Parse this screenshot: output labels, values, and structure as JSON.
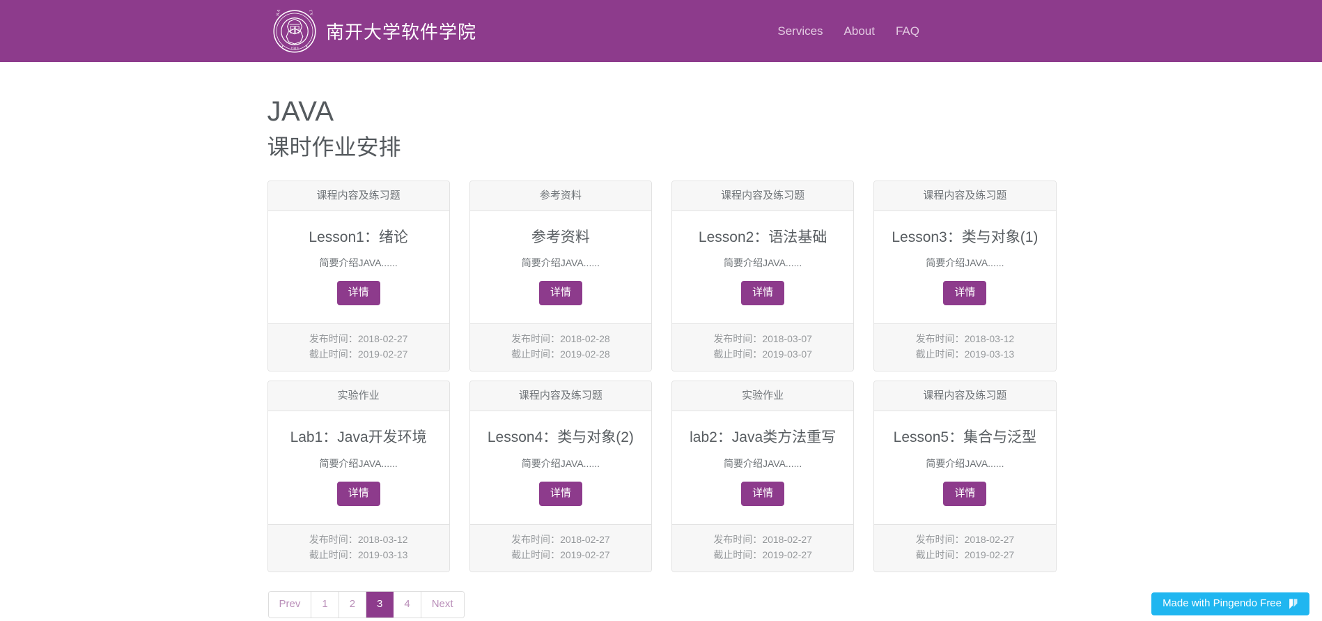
{
  "navbar": {
    "brand_text": "南开大学软件学院",
    "logo_name": "nankai-university-seal",
    "logo_ring_text": "NANKAI UNIVERSITY",
    "logo_year": "1919",
    "logo_chars": "南開",
    "links": [
      {
        "label": "Services"
      },
      {
        "label": "About"
      },
      {
        "label": "FAQ"
      }
    ]
  },
  "main": {
    "title": "JAVA",
    "subtitle": "课时作业安排",
    "published_label": "发布时间：",
    "deadline_label": "截止时间：",
    "detail_button": "详情",
    "cards": [
      {
        "category": "课程内容及练习题",
        "title": "Lesson1：绪论",
        "description": "简要介绍JAVA......",
        "button": "详情",
        "published": "2018-02-27",
        "deadline": "2019-02-27"
      },
      {
        "category": "参考资料",
        "title": "参考资料",
        "description": "简要介绍JAVA......",
        "button": "详情",
        "published": "2018-02-28",
        "deadline": "2019-02-28"
      },
      {
        "category": "课程内容及练习题",
        "title": "Lesson2：语法基础",
        "description": "简要介绍JAVA......",
        "button": "详情",
        "published": "2018-03-07",
        "deadline": "2019-03-07"
      },
      {
        "category": "课程内容及练习题",
        "title": "Lesson3：类与对象(1)",
        "description": "简要介绍JAVA......",
        "button": "详情",
        "published": "2018-03-12",
        "deadline": "2019-03-13"
      },
      {
        "category": "实验作业",
        "title": "Lab1：Java开发环境",
        "description": "简要介绍JAVA......",
        "button": "详情",
        "published": "2018-03-12",
        "deadline": "2019-03-13"
      },
      {
        "category": "课程内容及练习题",
        "title": "Lesson4：类与对象(2)",
        "description": "简要介绍JAVA......",
        "button": "详情",
        "published": "2018-02-27",
        "deadline": "2019-02-27"
      },
      {
        "category": "实验作业",
        "title": "lab2：Java类方法重写",
        "description": "简要介绍JAVA......",
        "button": "详情",
        "published": "2018-02-27",
        "deadline": "2019-02-27"
      },
      {
        "category": "课程内容及练习题",
        "title": "Lesson5：集合与泛型",
        "description": "简要介绍JAVA......",
        "button": "详情",
        "published": "2018-02-27",
        "deadline": "2019-02-27"
      }
    ]
  },
  "pagination": {
    "prev_label": "Prev",
    "next_label": "Next",
    "pages": [
      "1",
      "2",
      "3",
      "4"
    ],
    "active_page": "3"
  },
  "badge": {
    "label": "Made with Pingendo Free",
    "icon_name": "pingendo-logo-icon"
  },
  "colors": {
    "brand_purple": "#8d3b8c",
    "nav_link": "#e3cbe2",
    "card_header_bg": "#f7f7f7",
    "card_border": "#e3e3e3",
    "text_dark": "#585d61",
    "text_muted": "#96999c",
    "badge_blue": "#20b6f0"
  }
}
